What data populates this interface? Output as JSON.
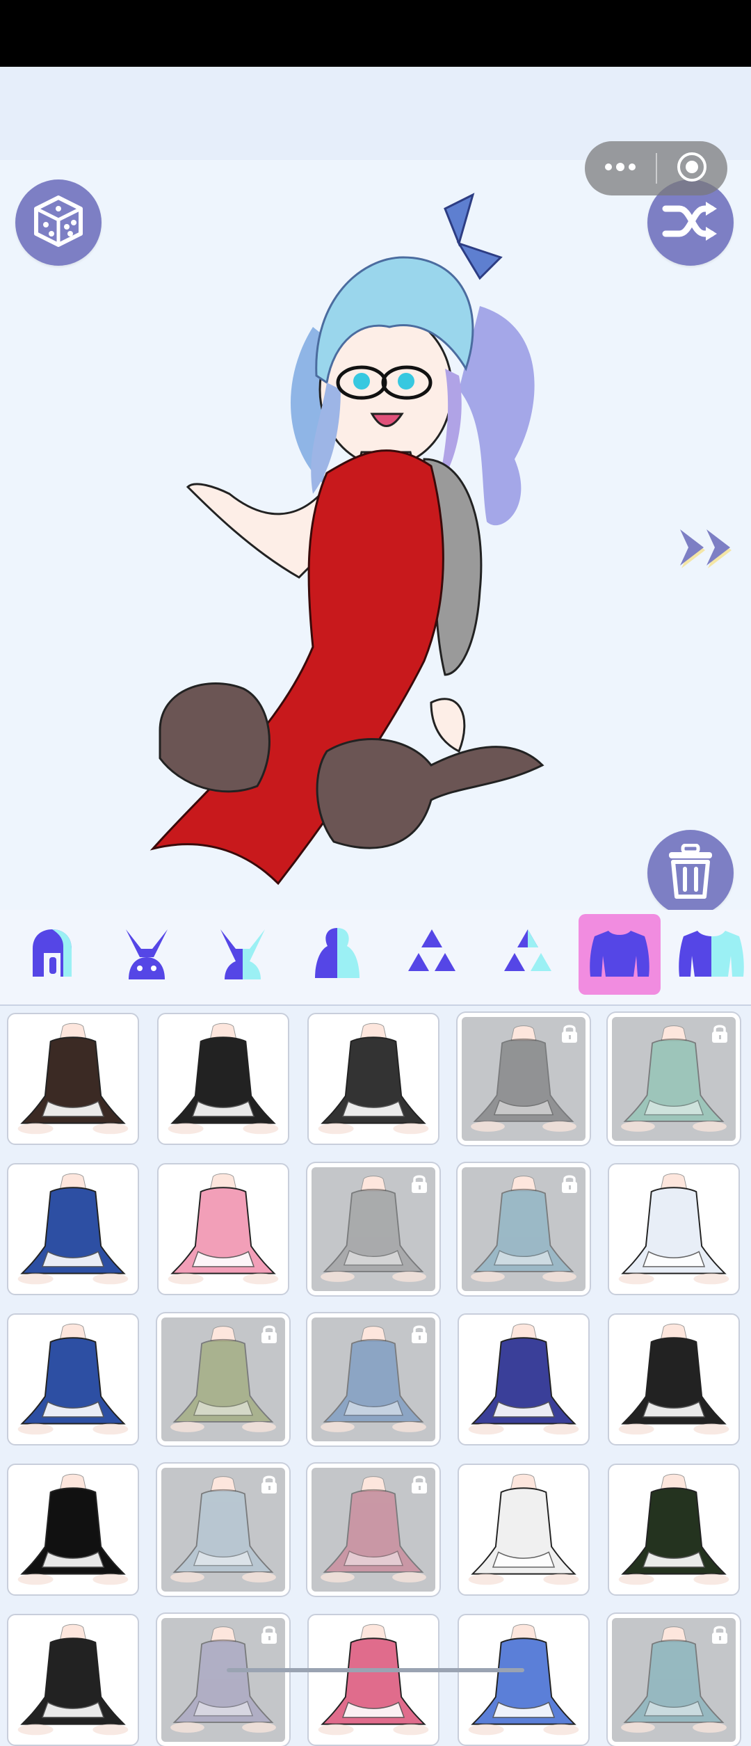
{
  "colors": {
    "accent": "#7d7fc4",
    "active_category": "#f18ce0",
    "category_icon": "#5546e6",
    "category_icon_light": "#9bf0f4",
    "locked_tile": "#c4c6c9"
  },
  "toolbar": {
    "random_button_icon": "dice-icon",
    "shuffle_button_icon": "shuffle-icon",
    "delete_button_icon": "trash-icon",
    "next_icon": "double-chevron-right-icon"
  },
  "miniprogram_capsule": {
    "more_icon": "more-dots-icon",
    "close_icon": "target-circle-icon"
  },
  "categories": [
    {
      "name": "hair-back",
      "icon": "hair-icon",
      "active": false
    },
    {
      "name": "bunny-ears",
      "icon": "bunny-ears-icon",
      "active": false
    },
    {
      "name": "bunny-ears-color",
      "icon": "bunny-ears-color-icon",
      "active": false
    },
    {
      "name": "body",
      "icon": "body-icon",
      "active": false
    },
    {
      "name": "accessory",
      "icon": "triangles-icon",
      "active": false
    },
    {
      "name": "accessory-color",
      "icon": "triangles-color-icon",
      "active": false
    },
    {
      "name": "outfit",
      "icon": "shirt-icon",
      "active": true
    },
    {
      "name": "outfit-color",
      "icon": "shirt-color-icon",
      "active": false
    }
  ],
  "outfits": [
    {
      "style": "maid-brown",
      "locked": false
    },
    {
      "style": "maid-black",
      "locked": false
    },
    {
      "style": "gothic-lolita",
      "locked": false
    },
    {
      "style": "striped-maid",
      "locked": true
    },
    {
      "style": "green-maid",
      "locked": true
    },
    {
      "style": "blue-sailor",
      "locked": false
    },
    {
      "style": "pink-lolita",
      "locked": false
    },
    {
      "style": "grey-dress",
      "locked": true
    },
    {
      "style": "striped-blue-dress",
      "locked": true
    },
    {
      "style": "white-sailor",
      "locked": false
    },
    {
      "style": "sailor-blue-skirt",
      "locked": false
    },
    {
      "style": "green-maid-2",
      "locked": true
    },
    {
      "style": "sailor-blue-pleated",
      "locked": true
    },
    {
      "style": "navy-frill",
      "locked": false
    },
    {
      "style": "black-frill",
      "locked": false
    },
    {
      "style": "maid-white-apron",
      "locked": false
    },
    {
      "style": "light-blue-dress",
      "locked": true
    },
    {
      "style": "pink-kimono",
      "locked": true
    },
    {
      "style": "white-frill",
      "locked": false
    },
    {
      "style": "dark-green-qipao",
      "locked": false
    },
    {
      "style": "cow-print",
      "locked": false
    },
    {
      "style": "lavender-dress",
      "locked": true
    },
    {
      "style": "pink-sailor",
      "locked": false
    },
    {
      "style": "blue-ribbon",
      "locked": false
    },
    {
      "style": "teal-dress",
      "locked": true
    }
  ]
}
